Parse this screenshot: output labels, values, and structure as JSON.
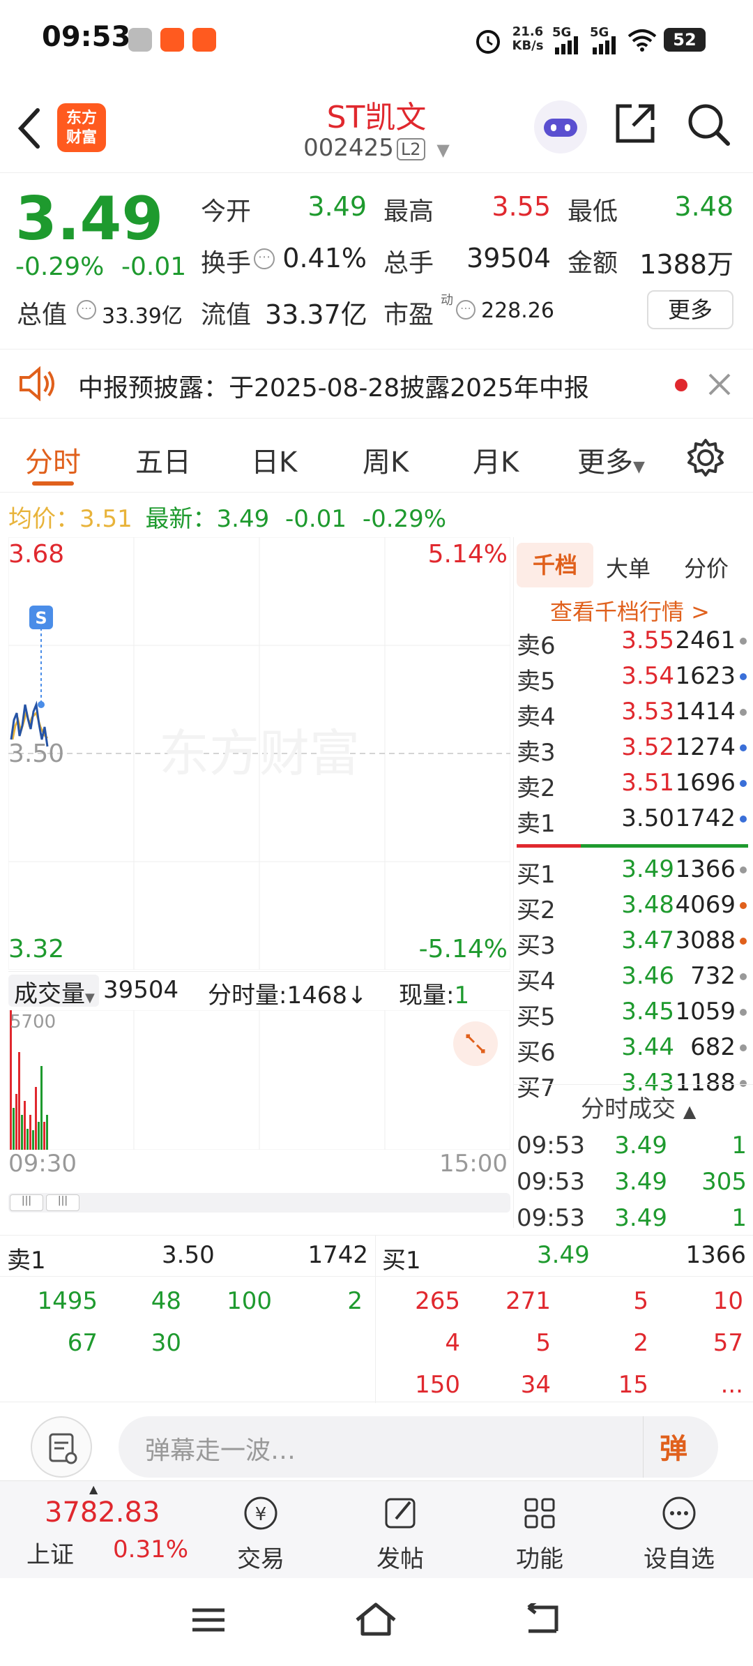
{
  "status": {
    "time": "09:53",
    "speed_top": "21.6",
    "speed_unit": "KB/s",
    "net1": "5G",
    "net2": "5G",
    "battery": "52"
  },
  "header": {
    "logo_line1": "东方",
    "logo_line2": "财富",
    "title": "ST凯文",
    "code": "002425",
    "code_badge": "L2"
  },
  "quote": {
    "price": "3.49",
    "change_pct": "-0.29%",
    "change": "-0.01",
    "open_label": "今开",
    "open": "3.49",
    "high_label": "最高",
    "high": "3.55",
    "low_label": "最低",
    "low": "3.48",
    "turnover_label": "换手",
    "turnover": "0.41%",
    "volume_label": "总手",
    "volume": "39504",
    "amount_label": "金额",
    "amount": "1388万",
    "mcap_label": "总值",
    "mcap": "33.39亿",
    "float_label": "流值",
    "float": "33.37亿",
    "pe_label": "市盈",
    "pe_sup": "动",
    "pe": "228.26",
    "more": "更多"
  },
  "notice": {
    "text": "中报预披露：于2025-08-28披露2025年中报"
  },
  "tabs": [
    {
      "label": "分时"
    },
    {
      "label": "五日"
    },
    {
      "label": "日K"
    },
    {
      "label": "周K"
    },
    {
      "label": "月K"
    },
    {
      "label": "更多"
    }
  ],
  "infoline": {
    "avg_label": "均价：",
    "avg": "3.51",
    "latest_label": "最新：",
    "latest": "3.49",
    "chg": "-0.01",
    "pct": "-0.29%"
  },
  "chart": {
    "top_price": "3.68",
    "top_pct": "5.14%",
    "mid_price": "3.50",
    "bottom_price": "3.32",
    "bottom_pct": "-5.14%",
    "watermark": "东方财富",
    "marker": "S",
    "time_start": "09:30",
    "time_end": "15:00",
    "vol_label": "成交量",
    "vol_total": "39504",
    "tick_label": "分时量:",
    "tick_value": "1468",
    "now_label": "现量:",
    "now_value": "1",
    "vol_axis": "5700"
  },
  "book": {
    "tabs": [
      "千档",
      "大单",
      "分价"
    ],
    "link": "查看千档行情 >",
    "asks": [
      {
        "label": "卖6",
        "price": "3.55",
        "vol": "2461",
        "dot": "#999"
      },
      {
        "label": "卖5",
        "price": "3.54",
        "vol": "1623",
        "dot": "#3a6fd8"
      },
      {
        "label": "卖4",
        "price": "3.53",
        "vol": "1414",
        "dot": "#999"
      },
      {
        "label": "卖3",
        "price": "3.52",
        "vol": "1274",
        "dot": "#3a6fd8"
      },
      {
        "label": "卖2",
        "price": "3.51",
        "vol": "1696",
        "dot": "#3a6fd8"
      },
      {
        "label": "卖1",
        "price": "3.50",
        "vol": "1742",
        "dot": "#3a6fd8"
      }
    ],
    "bids": [
      {
        "label": "买1",
        "price": "3.49",
        "vol": "1366",
        "dot": "#999"
      },
      {
        "label": "买2",
        "price": "3.48",
        "vol": "4069",
        "dot": "#e0601c"
      },
      {
        "label": "买3",
        "price": "3.47",
        "vol": "3088",
        "dot": "#e0601c"
      },
      {
        "label": "买4",
        "price": "3.46",
        "vol": "732",
        "dot": "#999"
      },
      {
        "label": "买5",
        "price": "3.45",
        "vol": "1059",
        "dot": "#999"
      },
      {
        "label": "买6",
        "price": "3.44",
        "vol": "682",
        "dot": "#999"
      },
      {
        "label": "买7",
        "price": "3.43",
        "vol": "1188",
        "dot": "#999"
      }
    ],
    "trades_title": "分时成交",
    "trades": [
      {
        "time": "09:53",
        "price": "3.49",
        "vol": "1"
      },
      {
        "time": "09:53",
        "price": "3.49",
        "vol": "305"
      },
      {
        "time": "09:53",
        "price": "3.49",
        "vol": "1"
      }
    ]
  },
  "bottom_book": {
    "ask_label": "卖1",
    "ask_price": "3.50",
    "ask_vol": "1742",
    "bid_label": "买1",
    "bid_price": "3.49",
    "bid_vol": "1366",
    "ask_rows": [
      [
        "1495",
        "48",
        "100",
        "2"
      ],
      [
        "67",
        "30",
        "",
        ""
      ]
    ],
    "bid_rows": [
      [
        "265",
        "271",
        "5",
        "10"
      ],
      [
        "4",
        "5",
        "2",
        "57"
      ],
      [
        "150",
        "34",
        "15",
        "..."
      ]
    ]
  },
  "comment": {
    "placeholder": "弹幕走一波…",
    "danmu": "弹"
  },
  "bottom_nav": {
    "index_value": "3782.83",
    "index_name": "上证",
    "index_pct": "0.31%",
    "items": [
      {
        "label": "交易"
      },
      {
        "label": "发帖"
      },
      {
        "label": "功能"
      },
      {
        "label": "设自选"
      }
    ]
  },
  "colors": {
    "up": "#e0282e",
    "down": "#1e9a2e",
    "accent": "#ff5a1f",
    "avg": "#e8b33a"
  }
}
